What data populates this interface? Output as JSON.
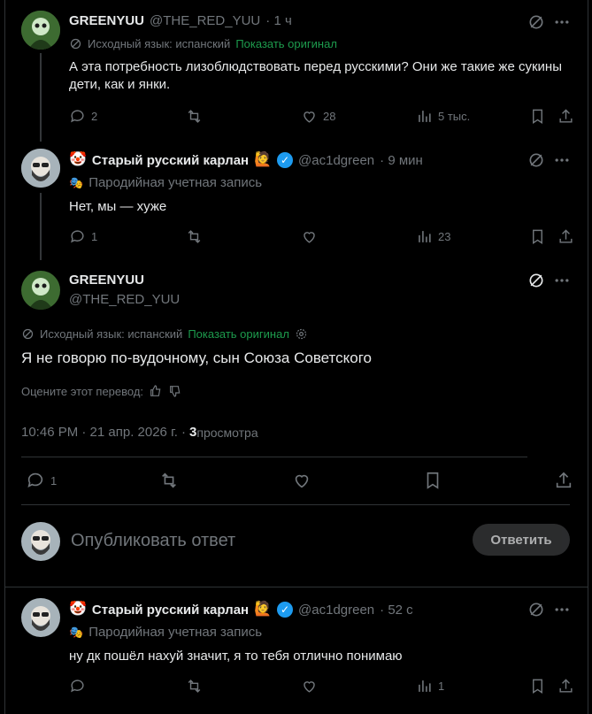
{
  "posts": [
    {
      "name": "GREENYUU",
      "handle": "@THE_RED_YUU",
      "time": "· 1 ч",
      "translate_label": "Исходный язык: испанский",
      "translate_link": "Показать оригинал",
      "text": "А эта потребность лизоблюдствовать перед русскими? Они же такие же сукины дети, как и янки.",
      "replies": "2",
      "likes": "28",
      "views": "5 тыс."
    },
    {
      "name": "Старый русский карлан",
      "handle": "@ac1dgreen",
      "time": "· 9 мин",
      "parody": "Пародийная учетная запись",
      "text": "Нет, мы — хуже",
      "replies": "1",
      "likes": "",
      "views": "23"
    },
    {
      "name": "Старый русский карлан",
      "handle": "@ac1dgreen",
      "time": "· 52 с",
      "parody": "Пародийная учетная запись",
      "text": "ну дк пошёл нахуй значит, я то тебя отлично понимаю",
      "replies": "",
      "likes": "",
      "views": "1"
    }
  ],
  "focus": {
    "name": "GREENYUU",
    "handle": "@THE_RED_YUU",
    "translate_label": "Исходный язык: испанский",
    "translate_link": "Показать оригинал",
    "text": "Я не говорю по-вудочному, сын Союза Советского",
    "rate_label": "Оцените этот перевод:",
    "meta_time": "10:46 PM · 21 апр. 2026 г. · ",
    "meta_views_num": "3",
    "meta_views_label": " просмотра",
    "replies": "1"
  },
  "composer": {
    "placeholder": "Опубликовать ответ",
    "button": "Ответить"
  },
  "colors": {
    "accent_green": "#1d9b4d",
    "verified": "#1d9bf0",
    "muted": "#71767b"
  }
}
